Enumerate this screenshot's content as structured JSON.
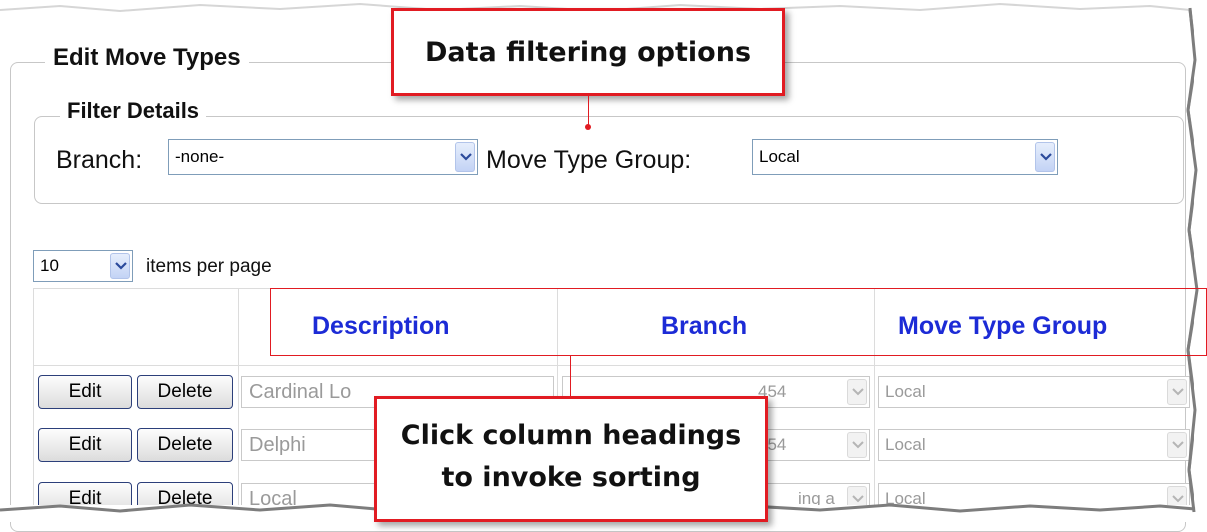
{
  "panel": {
    "title": "Edit Move Types",
    "filter": {
      "title": "Filter Details",
      "branch_label": "Branch:",
      "branch_value": "-none-",
      "group_label": "Move Type Group:",
      "group_value": "Local"
    }
  },
  "paging": {
    "page_size": "10",
    "items_label": "items per page"
  },
  "grid": {
    "headers": [
      "Description",
      "Branch",
      "Move Type Group"
    ],
    "rows": [
      {
        "edit": "Edit",
        "delete": "Delete",
        "description": "Cardinal Lo",
        "branch": "454",
        "branch_prefix": "",
        "group": "Local"
      },
      {
        "edit": "Edit",
        "delete": "Delete",
        "description": "Delphi",
        "branch": "454",
        "branch_prefix": "",
        "group": "Local"
      },
      {
        "edit": "Edit",
        "delete": "Delete",
        "description": "Local",
        "branch": "ing a",
        "branch_prefix": "",
        "group": "Local"
      }
    ]
  },
  "callouts": {
    "filtering": "Data filtering options",
    "sorting_line1": "Click column headings",
    "sorting_line2": "to invoke sorting"
  },
  "colors": {
    "callout_border": "#e11b22",
    "link": "#1c2bd6"
  },
  "icons": {
    "dropdown": "chevron-down-icon"
  }
}
